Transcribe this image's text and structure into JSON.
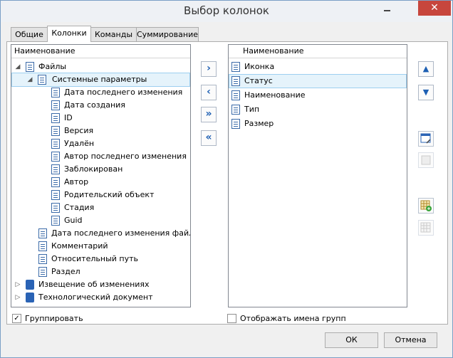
{
  "window": {
    "title": "Выбор колонок",
    "close_glyph": "✕"
  },
  "tabs": [
    "Общие",
    "Колонки",
    "Команды",
    "Суммирование"
  ],
  "left_list": {
    "header": "Наименование",
    "items": [
      "Файлы",
      "Системные параметры",
      "Дата последнего изменения",
      "Дата создания",
      "ID",
      "Версия",
      "Удалён",
      "Автор последнего изменения",
      "Заблокирован",
      "Автор",
      "Родительский объект",
      "Стадия",
      "Guid",
      "Дата последнего изменения файла",
      "Комментарий",
      "Относительный путь",
      "Раздел",
      "Извещение об изменениях",
      "Технологический документ"
    ]
  },
  "right_list": {
    "header": "Наименование",
    "items": [
      "Иконка",
      "Статус",
      "Наименование",
      "Тип",
      "Размер"
    ]
  },
  "move_buttons": {
    "add": "›",
    "remove": "‹",
    "add_all": "»",
    "remove_all": "«"
  },
  "order_buttons": {
    "up": "▲",
    "down": "▼"
  },
  "group_checkbox": {
    "label": "Группировать",
    "checked": true,
    "mark": "✓"
  },
  "show_groups_checkbox": {
    "label": "Отображать имена групп",
    "checked": false
  },
  "ok_button": "ОК",
  "cancel_button": "Отмена",
  "icons": [
    "chevron-right-icon",
    "chevron-left-icon",
    "double-chevron-right-icon",
    "double-chevron-left-icon",
    "arrow-up-icon",
    "arrow-down-icon",
    "column-edit-icon",
    "column-copy-icon",
    "grid-add-icon",
    "grid-icon",
    "document-icon",
    "folder-icon"
  ],
  "colors": {
    "accent": "#1d5fb3",
    "close": "#c7463d",
    "selection": "#e5f3fb"
  }
}
